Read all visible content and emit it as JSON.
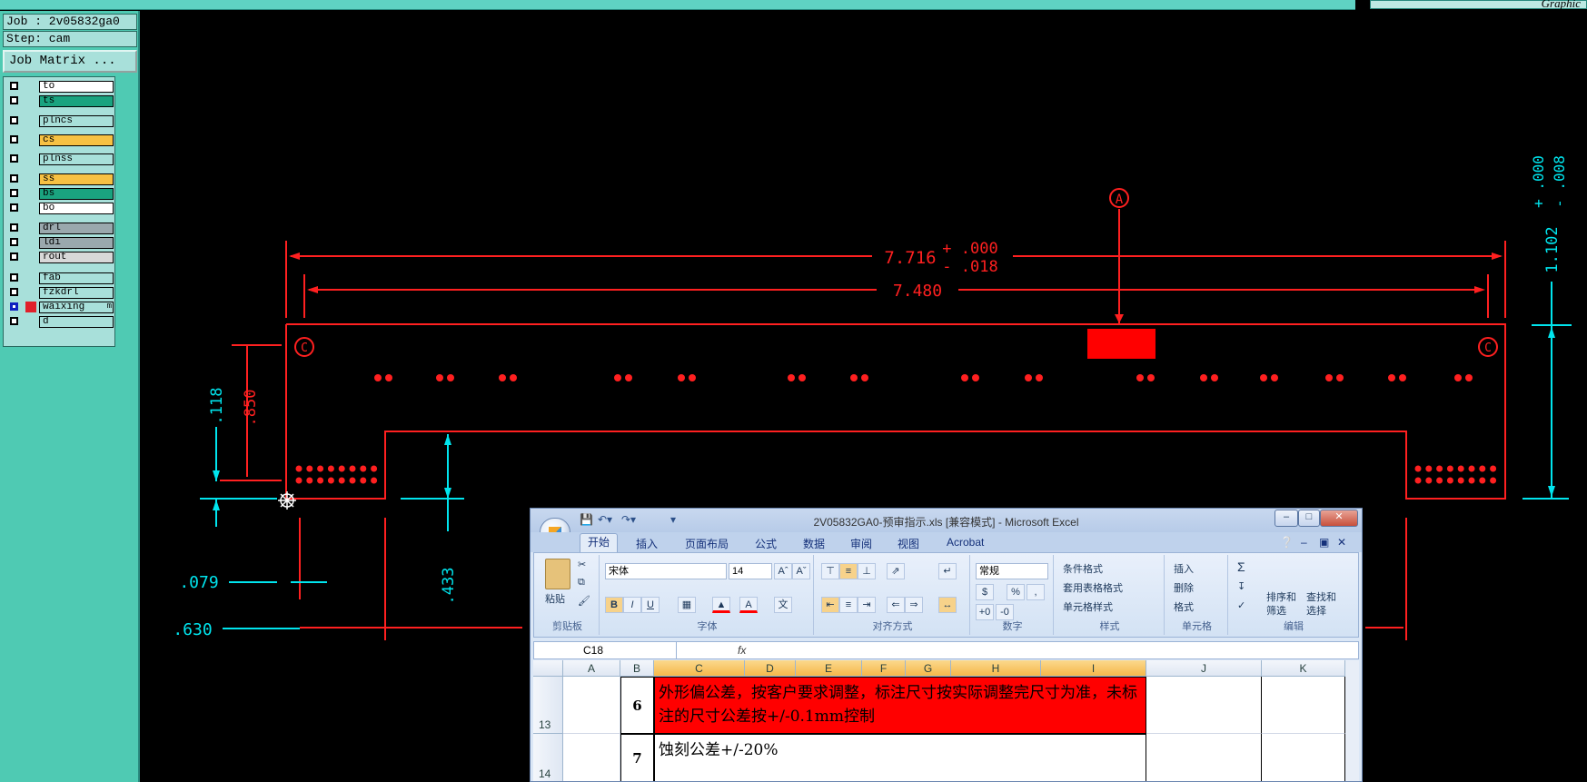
{
  "topbar": {
    "right_text": "Graphic"
  },
  "sidebar": {
    "job": "Job : 2v05832ga0",
    "step": "Step: cam",
    "job_matrix_label": "Job Matrix ...",
    "layers": [
      {
        "name": "to",
        "color": "#ffffff"
      },
      {
        "name": "ts",
        "color": "#1aa37f"
      },
      {
        "name": "plncs",
        "color": "#a8e0da"
      },
      {
        "name": "cs",
        "color": "#f7c143"
      },
      {
        "name": "plnss",
        "color": "#a8e0da"
      },
      {
        "name": "ss",
        "color": "#f7c143"
      },
      {
        "name": "bs",
        "color": "#1aa37f"
      },
      {
        "name": "bo",
        "color": "#ffffff"
      },
      {
        "name": "drl",
        "color": "#9aa8ad"
      },
      {
        "name": "ldi",
        "color": "#9aa8ad"
      },
      {
        "name": "rout",
        "color": "#d8d8d8"
      },
      {
        "name": "fab",
        "color": "#a8e0da"
      },
      {
        "name": "fzkdrl",
        "color": "#a8e0da"
      },
      {
        "name": "waixing",
        "color": "#a8e0da",
        "suffix": "m"
      },
      {
        "name": "d",
        "color": "#a8e0da"
      }
    ]
  },
  "drawing": {
    "dim_7716": "7.716",
    "tol_plus": "+ .000",
    "tol_minus": "- .018",
    "dim_7480": "7.480",
    "datum_a": "A",
    "datum_c": "C",
    "dim_118": ".118",
    "dim_850": ".850",
    "dim_433": ".433",
    "dim_079": ".079",
    "dim_630": ".630",
    "dim_1102": "1.102",
    "right_tol_plus": "+ .000",
    "right_tol_minus": "- .008",
    "colors": {
      "outline": "#ff2020",
      "dimension": "#00e5ee"
    }
  },
  "excel": {
    "title": "2V05832GA0-预审指示.xls  [兼容模式] - Microsoft Excel",
    "tabs": [
      "开始",
      "插入",
      "页面布局",
      "公式",
      "数据",
      "审阅",
      "视图",
      "Acrobat"
    ],
    "groups": {
      "clipboard": "剪贴板",
      "font": "字体",
      "alignment": "对齐方式",
      "number": "数字",
      "styles": "样式",
      "cells": "单元格",
      "editing": "编辑"
    },
    "paste_label": "粘贴",
    "font_name": "宋体",
    "font_size": "14",
    "number_format": "常规",
    "styles_items": [
      "条件格式",
      "套用表格格式",
      "单元格样式"
    ],
    "cells_items": [
      "插入",
      "删除",
      "格式"
    ],
    "sort_label": "排序和\n筛选",
    "find_label": "查找和\n选择",
    "name_box": "C18",
    "fx": "fx",
    "columns": [
      "A",
      "B",
      "C",
      "D",
      "E",
      "F",
      "G",
      "H",
      "I",
      "J",
      "K"
    ],
    "rows": [
      {
        "num": "13",
        "b": "6",
        "text": "外形偏公差，按客户要求调整，标注尺寸按实际调整完尺寸为准，未标注的尺寸公差按+/-0.1mm控制",
        "highlight": "#ff0000"
      },
      {
        "num": "14",
        "b": "7",
        "text": "蚀刻公差+/-20%",
        "highlight": "#ffffff"
      }
    ]
  }
}
